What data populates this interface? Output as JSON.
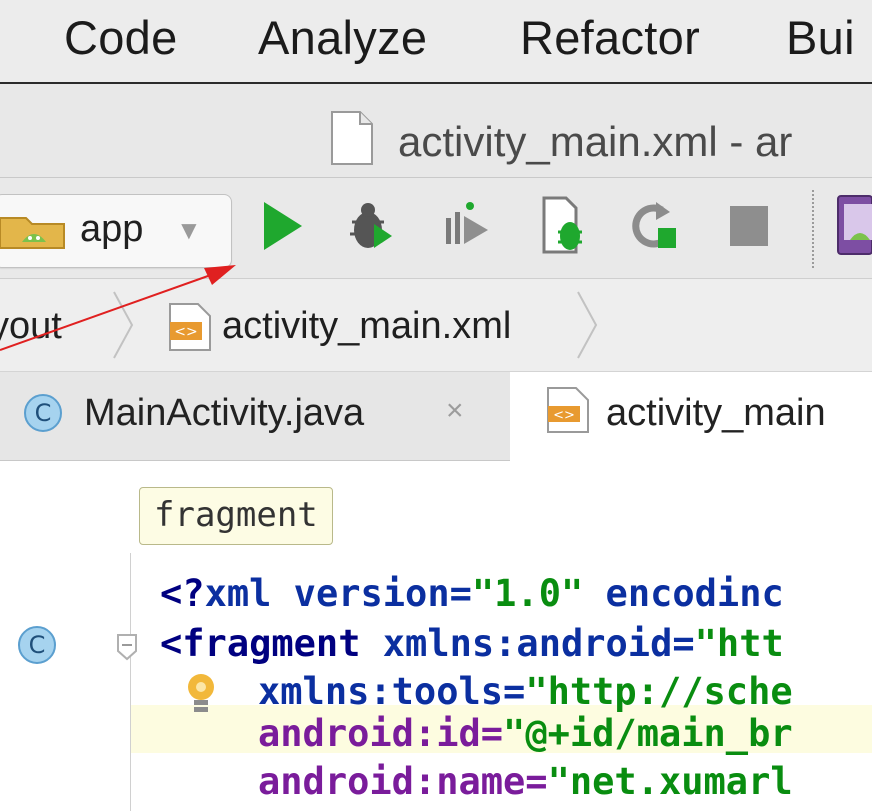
{
  "menu": {
    "items": [
      "Code",
      "Analyze",
      "Refactor",
      "Bui"
    ]
  },
  "window": {
    "title": "activity_main.xml - ar"
  },
  "toolbar": {
    "run_config": "app",
    "icons": [
      "run-icon",
      "debug-icon",
      "attach-debugger-icon",
      "debug-bug-icon",
      "rerun-icon",
      "stop-icon",
      "avd-manager-icon"
    ]
  },
  "breadcrumb": {
    "items": [
      "yout",
      "activity_main.xml"
    ]
  },
  "tabs": {
    "items": [
      {
        "label": "MainActivity.java",
        "close": "×",
        "badge": "C"
      },
      {
        "label": "activity_main"
      }
    ]
  },
  "editor": {
    "tag_label": "fragment",
    "gutter_badge": "C",
    "lines": [
      {
        "parts": [
          "<?",
          "xml version=",
          "\"1.0\"",
          " encodinc"
        ]
      },
      {
        "parts": [
          "<",
          "fragment ",
          "xmlns:android=",
          "\"htt"
        ]
      },
      {
        "parts": [
          "xmlns:tools=",
          "\"http://sche"
        ]
      },
      {
        "parts": [
          "android:id=",
          "\"@+id/main_br"
        ]
      },
      {
        "parts": [
          "android:name=",
          "\"net.xumarl"
        ]
      }
    ]
  },
  "colors": {
    "run_green": "#1fa82e",
    "annotation_red": "#e02020",
    "xml_tag": "#0b2fa0",
    "xml_value": "#098d10",
    "attr_purple": "#7a1c9b"
  }
}
